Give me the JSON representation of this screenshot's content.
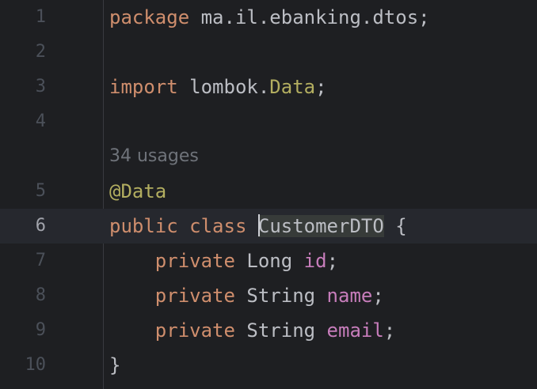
{
  "line_numbers": [
    "1",
    "2",
    "3",
    "4",
    "5",
    "6",
    "7",
    "8",
    "9",
    "10"
  ],
  "code": {
    "line1": {
      "keyword": "package",
      "rest": " ma.il.ebanking.dtos;"
    },
    "line3": {
      "keyword": "import",
      "pkg": " lombok.",
      "cls": "Data",
      "semi": ";"
    },
    "usages_hint": "34 usages",
    "line5": {
      "annotation": "@Data"
    },
    "line6": {
      "kw1": "public",
      "kw2": " class ",
      "name_first": "C",
      "name_rest": "ustomerDTO",
      "brace": " {"
    },
    "line7": {
      "indent": "    ",
      "kw": "private",
      "type": " Long ",
      "field": "id",
      "semi": ";"
    },
    "line8": {
      "indent": "    ",
      "kw": "private",
      "type": " String ",
      "field": "name",
      "semi": ";"
    },
    "line9": {
      "indent": "    ",
      "kw": "private",
      "type": " String ",
      "field": "email",
      "semi": ";"
    },
    "line10": {
      "brace": "}"
    }
  },
  "colors": {
    "background": "#1e1f22",
    "keyword": "#cf8e6d",
    "annotation": "#b3ae60",
    "field": "#c77dbb",
    "text": "#bcbec4",
    "line_number": "#4b5059",
    "current_line": "#26282e"
  }
}
